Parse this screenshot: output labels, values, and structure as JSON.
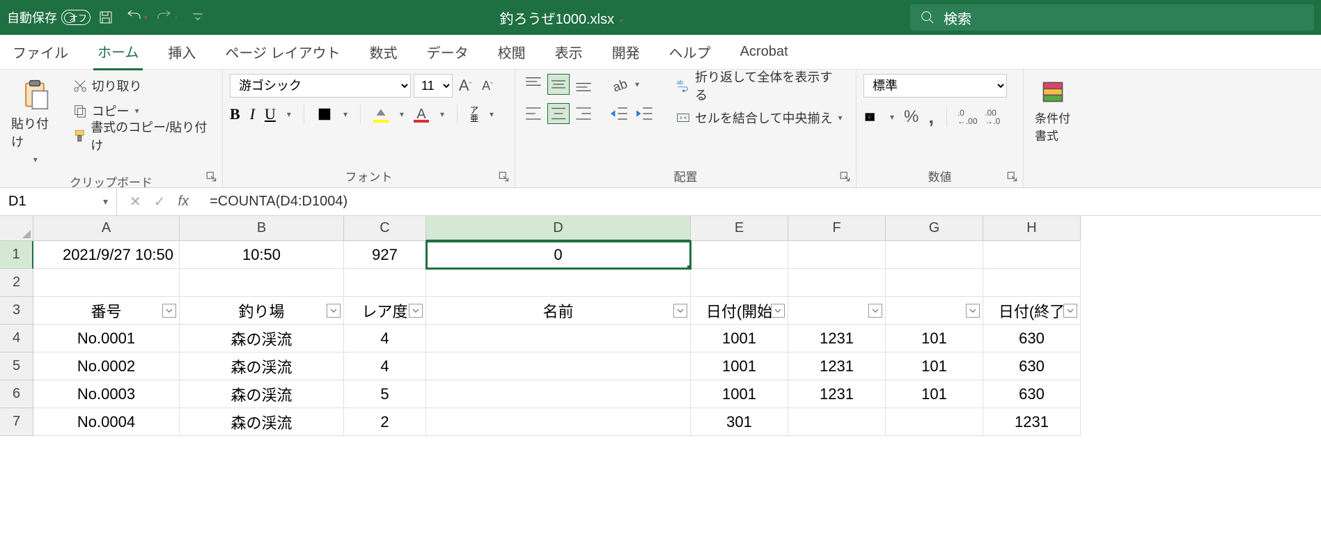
{
  "titleBar": {
    "autosave": "自動保存",
    "autosaveState": "オフ",
    "filename": "釣ろうぜ1000.xlsx",
    "searchPlaceholder": "検索"
  },
  "tabs": {
    "file": "ファイル",
    "home": "ホーム",
    "insert": "挿入",
    "layout": "ページ レイアウト",
    "formulas": "数式",
    "data": "データ",
    "review": "校閲",
    "view": "表示",
    "developer": "開発",
    "help": "ヘルプ",
    "acrobat": "Acrobat"
  },
  "ribbon": {
    "clipboard": {
      "label": "クリップボード",
      "paste": "貼り付け",
      "cut": "切り取り",
      "copy": "コピー",
      "formatPainter": "書式のコピー/貼り付け"
    },
    "font": {
      "label": "フォント",
      "name": "游ゴシック",
      "size": "11",
      "ruby": "ア\n亜"
    },
    "alignment": {
      "label": "配置",
      "wrap": "折り返して全体を表示する",
      "merge": "セルを結合して中央揃え"
    },
    "number": {
      "label": "数値",
      "format": "標準"
    },
    "styles": {
      "conditional": "条件付\n書式"
    }
  },
  "nameBox": "D1",
  "formula": "=COUNTA(D4:D1004)",
  "columns": [
    "A",
    "B",
    "C",
    "D",
    "E",
    "F",
    "G",
    "H"
  ],
  "rowNums": [
    "1",
    "2",
    "3",
    "4",
    "5",
    "6",
    "7"
  ],
  "headerRow": {
    "A": "番号",
    "B": "釣り場",
    "C": "レア度",
    "D": "名前",
    "E": "日付(開始",
    "F": "",
    "G": "",
    "H": "日付(終了"
  },
  "rows": [
    {
      "A": "2021/9/27 10:50",
      "B": "10:50",
      "C": "927",
      "D": "0",
      "E": "",
      "F": "",
      "G": "",
      "H": ""
    },
    {
      "A": "",
      "B": "",
      "C": "",
      "D": "",
      "E": "",
      "F": "",
      "G": "",
      "H": ""
    },
    {
      "A": "No.0001",
      "B": "森の渓流",
      "C": "4",
      "D": "",
      "E": "1001",
      "F": "1231",
      "G": "101",
      "H": "630"
    },
    {
      "A": "No.0002",
      "B": "森の渓流",
      "C": "4",
      "D": "",
      "E": "1001",
      "F": "1231",
      "G": "101",
      "H": "630"
    },
    {
      "A": "No.0003",
      "B": "森の渓流",
      "C": "5",
      "D": "",
      "E": "1001",
      "F": "1231",
      "G": "101",
      "H": "630"
    },
    {
      "A": "No.0004",
      "B": "森の渓流",
      "C": "2",
      "D": "",
      "E": "301",
      "F": "",
      "G": "",
      "H": "1231"
    }
  ]
}
